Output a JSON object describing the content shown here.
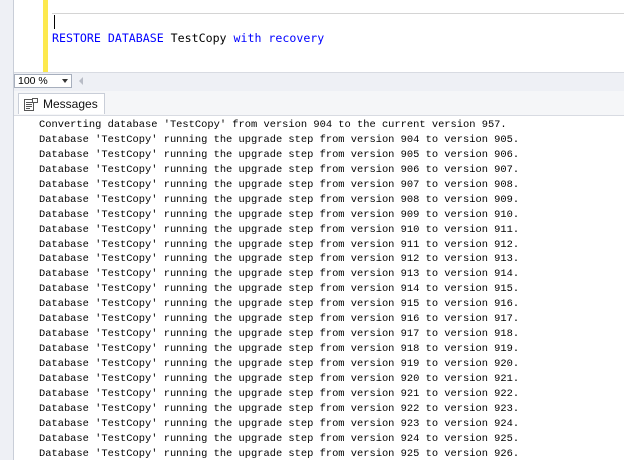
{
  "editor": {
    "query_tokens": [
      {
        "text": "RESTORE",
        "kind": "kw"
      },
      {
        "text": " ",
        "kind": "ident"
      },
      {
        "text": "DATABASE",
        "kind": "kw"
      },
      {
        "text": " TestCopy ",
        "kind": "ident"
      },
      {
        "text": "with",
        "kind": "kw"
      },
      {
        "text": " ",
        "kind": "ident"
      },
      {
        "text": "recovery",
        "kind": "kw"
      }
    ],
    "keyword_color": "#0000ff",
    "change_bar_color": "#fde94d"
  },
  "zoom": {
    "value": "100 %"
  },
  "results": {
    "tab_label": "Messages",
    "messages": [
      "Converting database 'TestCopy' from version 904 to the current version 957.",
      "Database 'TestCopy' running the upgrade step from version 904 to version 905.",
      "Database 'TestCopy' running the upgrade step from version 905 to version 906.",
      "Database 'TestCopy' running the upgrade step from version 906 to version 907.",
      "Database 'TestCopy' running the upgrade step from version 907 to version 908.",
      "Database 'TestCopy' running the upgrade step from version 908 to version 909.",
      "Database 'TestCopy' running the upgrade step from version 909 to version 910.",
      "Database 'TestCopy' running the upgrade step from version 910 to version 911.",
      "Database 'TestCopy' running the upgrade step from version 911 to version 912.",
      "Database 'TestCopy' running the upgrade step from version 912 to version 913.",
      "Database 'TestCopy' running the upgrade step from version 913 to version 914.",
      "Database 'TestCopy' running the upgrade step from version 914 to version 915.",
      "Database 'TestCopy' running the upgrade step from version 915 to version 916.",
      "Database 'TestCopy' running the upgrade step from version 916 to version 917.",
      "Database 'TestCopy' running the upgrade step from version 917 to version 918.",
      "Database 'TestCopy' running the upgrade step from version 918 to version 919.",
      "Database 'TestCopy' running the upgrade step from version 919 to version 920.",
      "Database 'TestCopy' running the upgrade step from version 920 to version 921.",
      "Database 'TestCopy' running the upgrade step from version 921 to version 922.",
      "Database 'TestCopy' running the upgrade step from version 922 to version 923.",
      "Database 'TestCopy' running the upgrade step from version 923 to version 924.",
      "Database 'TestCopy' running the upgrade step from version 924 to version 925.",
      "Database 'TestCopy' running the upgrade step from version 925 to version 926."
    ]
  }
}
